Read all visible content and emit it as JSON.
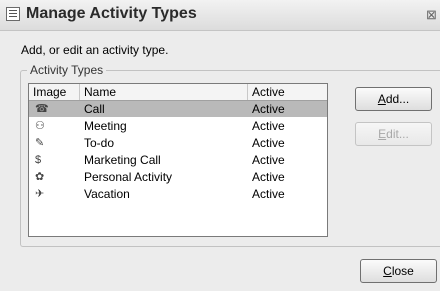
{
  "window": {
    "title": "Manage Activity Types",
    "app_icon": "window-icon",
    "close_glyph": "⊠"
  },
  "instructions": "Add, or edit an activity type.",
  "group": {
    "legend": "Activity Types"
  },
  "table": {
    "columns": [
      "Image",
      "Name",
      "Active"
    ],
    "selected_row": 0,
    "rows": [
      {
        "icon": "phone-icon",
        "glyph": "☎",
        "name": "Call",
        "active": "Active"
      },
      {
        "icon": "meeting-icon",
        "glyph": "⚇",
        "name": "Meeting",
        "active": "Active"
      },
      {
        "icon": "todo-icon",
        "glyph": "✎",
        "name": "To-do",
        "active": "Active"
      },
      {
        "icon": "marketing-call-icon",
        "glyph": "$",
        "name": "Marketing Call",
        "active": "Active"
      },
      {
        "icon": "personal-activity-icon",
        "glyph": "✿",
        "name": "Personal Activity",
        "active": "Active"
      },
      {
        "icon": "vacation-icon",
        "glyph": "✈",
        "name": "Vacation",
        "active": "Active"
      }
    ]
  },
  "buttons": {
    "add": {
      "mnemonic": "A",
      "rest": "dd..."
    },
    "edit": {
      "mnemonic": "E",
      "rest": "dit...",
      "disabled": true
    },
    "close": {
      "mnemonic": "C",
      "rest": "lose"
    }
  }
}
